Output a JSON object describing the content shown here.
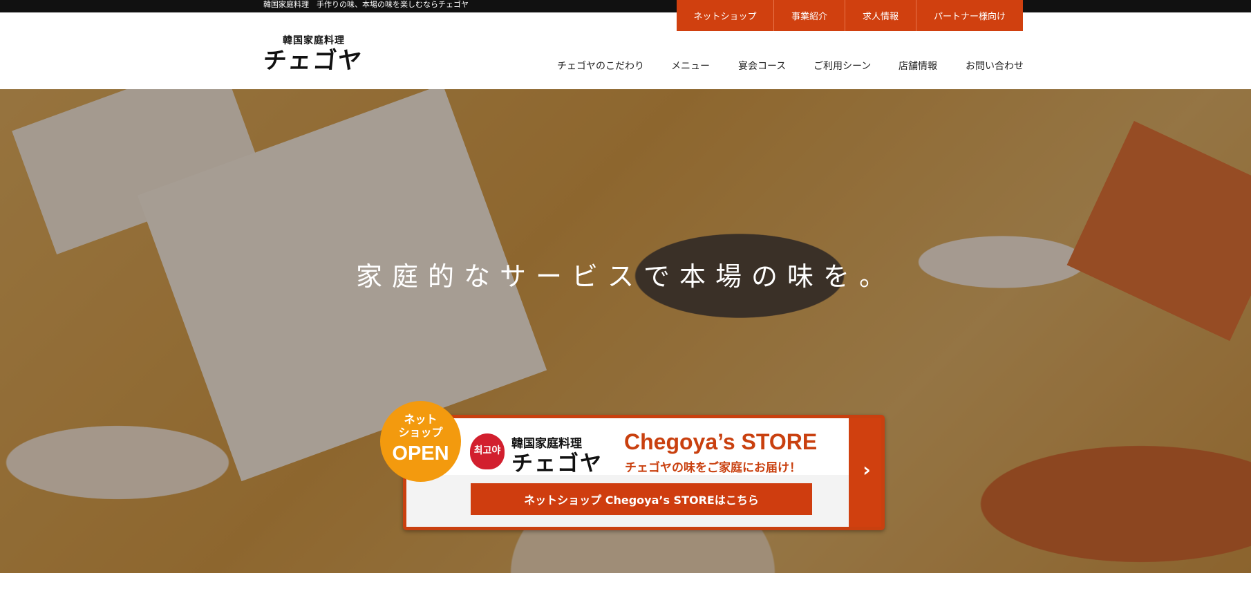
{
  "site": {
    "tagline": "韓国家庭料理　手作りの味、本場の味を楽しむならチェゴヤ",
    "logo_sub": "韓国家庭料理",
    "logo_main": "チェゴヤ"
  },
  "top_links": [
    {
      "label": "ネットショップ"
    },
    {
      "label": "事業紹介"
    },
    {
      "label": "求人情報"
    },
    {
      "label": "パートナー様向け"
    }
  ],
  "nav": [
    {
      "label": "チェゴヤのこだわり"
    },
    {
      "label": "メニュー"
    },
    {
      "label": "宴会コース"
    },
    {
      "label": "ご利用シーン"
    },
    {
      "label": "店舗情報"
    },
    {
      "label": "お問い合わせ"
    }
  ],
  "hero": {
    "headline": "家庭的なサービスで本場の味を。"
  },
  "badge": {
    "line1": "ネット",
    "line2": "ショップ",
    "line3": "OPEN"
  },
  "shop": {
    "emblem_text": "최고야",
    "logo_sub": "韓国家庭料理",
    "logo_main": "チェゴヤ",
    "title": "Chegoya’s STORE",
    "tagline": "チェゴヤの味をご家庭にお届け！",
    "cta_label": "ネットショップ Chegoya’s STOREはこちら",
    "arrow_icon": "chevron-right-icon"
  },
  "colors": {
    "accent": "#d0400f",
    "badge": "#f39a0e",
    "topbar": "#111111"
  }
}
